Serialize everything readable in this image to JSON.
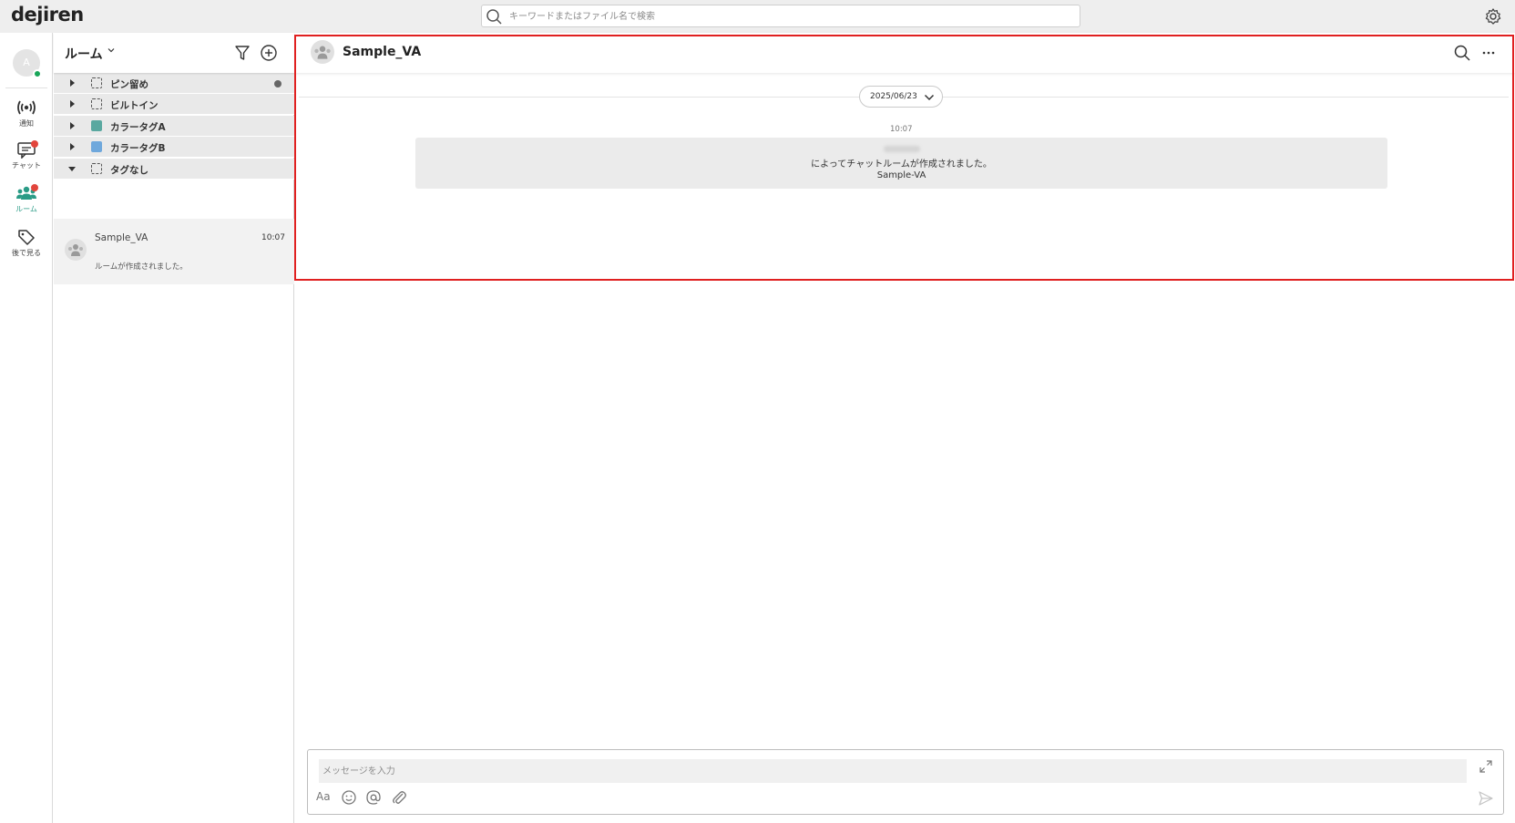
{
  "app": {
    "logo": "dejiren"
  },
  "global_search": {
    "placeholder": "キーワードまたはファイル名で検索"
  },
  "nav": {
    "avatar_initial": "A",
    "items": [
      {
        "label": "通知",
        "icon": "broadcast-icon"
      },
      {
        "label": "チャット",
        "icon": "chat-icon",
        "badge": true
      },
      {
        "label": "ルーム",
        "icon": "people-icon",
        "badge": true,
        "active": true
      },
      {
        "label": "後で見る",
        "icon": "tag-icon"
      }
    ]
  },
  "room_panel": {
    "title": "ルーム",
    "groups": [
      {
        "label": "ピン留め",
        "expanded": false,
        "marker": "checkbox",
        "has_dot": true
      },
      {
        "label": "ビルトイン",
        "expanded": false,
        "marker": "checkbox"
      },
      {
        "label": "カラータグA",
        "expanded": false,
        "marker": "color",
        "color": "#5aa8a0"
      },
      {
        "label": "カラータグB",
        "expanded": false,
        "marker": "color",
        "color": "#6fa8dc"
      },
      {
        "label": "タグなし",
        "expanded": true,
        "marker": "checkbox"
      }
    ],
    "rooms": [
      {
        "name": "Sample_VA",
        "time": "10:07",
        "preview": "ルームが作成されました。"
      }
    ]
  },
  "chat": {
    "title": "Sample_VA",
    "date": "2025/06/23",
    "messages": [
      {
        "time": "10:07",
        "text": "によってチャットルームが作成されました。",
        "sub": "Sample-VA"
      }
    ]
  },
  "composer": {
    "placeholder": "メッセージを入力",
    "font_label": "Aa"
  },
  "colors": {
    "accent": "#2a9b86",
    "badge": "#e2453c",
    "online": "#18a558",
    "highlight": "#e02020"
  }
}
